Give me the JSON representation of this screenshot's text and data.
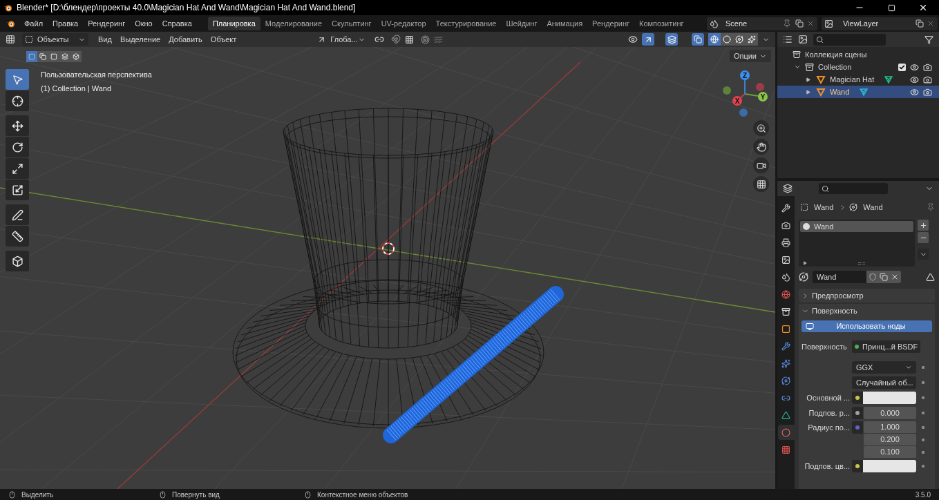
{
  "window": {
    "title": "Blender* [D:\\блендер\\проекты 40.0\\Magician Hat And Wand\\Magician Hat And Wand.blend]"
  },
  "menu": [
    "Файл",
    "Правка",
    "Рендеринг",
    "Окно",
    "Справка"
  ],
  "workspaces": [
    {
      "label": "Планировка",
      "selected": true
    },
    {
      "label": "Моделирование",
      "selected": false
    },
    {
      "label": "Скульптинг",
      "selected": false
    },
    {
      "label": "UV-редактор",
      "selected": false
    },
    {
      "label": "Текстурирование",
      "selected": false
    },
    {
      "label": "Шейдинг",
      "selected": false
    },
    {
      "label": "Анимация",
      "selected": false
    },
    {
      "label": "Рендеринг",
      "selected": false
    },
    {
      "label": "Композитинг",
      "selected": false
    }
  ],
  "scene": {
    "name": "Scene"
  },
  "view_layer": {
    "name": "ViewLayer"
  },
  "viewport_header": {
    "mode": "Объекты",
    "menus": [
      "Вид",
      "Выделение",
      "Добавить",
      "Объект"
    ],
    "orientation": "Глоба...",
    "shading": [
      {
        "kind": "wireframe",
        "selected": true
      },
      {
        "kind": "solid",
        "selected": false
      },
      {
        "kind": "material",
        "selected": false
      },
      {
        "kind": "rendered",
        "selected": false
      }
    ]
  },
  "viewport": {
    "select_modes": [
      {
        "kind": "new",
        "selected": true
      },
      {
        "kind": "extend",
        "selected": false
      },
      {
        "kind": "subtract",
        "selected": false
      },
      {
        "kind": "difference",
        "selected": false
      },
      {
        "kind": "intersect",
        "selected": false
      }
    ],
    "options": "Опции",
    "view_name": "Пользовательская перспектива",
    "object_info": "(1) Collection | Wand",
    "tools": [
      {
        "kind": "select",
        "selected": true
      },
      {
        "kind": "cursor",
        "selected": false
      },
      {
        "kind": "move",
        "selected": false
      },
      {
        "kind": "rotate",
        "selected": false
      },
      {
        "kind": "scale",
        "selected": false
      },
      {
        "kind": "transform",
        "selected": false
      },
      {
        "kind": "annotate",
        "selected": false
      },
      {
        "kind": "measure",
        "selected": false
      },
      {
        "kind": "add_cube",
        "selected": false
      }
    ],
    "gizmo_axes": [
      "X",
      "Y",
      "Z"
    ]
  },
  "outliner": {
    "root": "Коллекция сцены",
    "collection": {
      "name": "Collection",
      "expanded": true,
      "checked": true,
      "children": [
        {
          "name": "Magician Hat",
          "selected": false,
          "color": "#1fbf8f"
        },
        {
          "name": "Wand",
          "selected": true,
          "color": "#29b6d6"
        }
      ]
    }
  },
  "properties": {
    "tabs": [
      {
        "kind": "tool",
        "selected": false
      },
      {
        "kind": "render",
        "selected": false
      },
      {
        "kind": "output",
        "selected": false
      },
      {
        "kind": "view_layer",
        "selected": false
      },
      {
        "kind": "scene",
        "selected": false
      },
      {
        "kind": "world",
        "selected": false
      },
      {
        "kind": "collection",
        "selected": false
      },
      {
        "kind": "object",
        "selected": false
      },
      {
        "kind": "modifiers",
        "selected": false
      },
      {
        "kind": "particles",
        "selected": false
      },
      {
        "kind": "physics",
        "selected": false
      },
      {
        "kind": "constraints",
        "selected": false
      },
      {
        "kind": "data",
        "selected": false
      },
      {
        "kind": "material",
        "selected": true
      },
      {
        "kind": "texture",
        "selected": false
      }
    ],
    "breadcrumb": [
      "Wand",
      "Wand"
    ],
    "slots": [
      {
        "name": "Wand",
        "selected": true
      }
    ],
    "material_name": "Wand",
    "panels": [
      {
        "label": "Предпросмотр",
        "expanded": false
      },
      {
        "label": "Поверхность",
        "expanded": true
      }
    ],
    "use_nodes": "Использовать ноды",
    "rows": [
      {
        "kind": "link",
        "label": "Поверхность",
        "value": "Принц...й BSDF",
        "color": "#4caf50"
      },
      {
        "kind": "dropdown",
        "value": "GGX"
      },
      {
        "kind": "dropdown",
        "value": "Случайный об..."
      },
      {
        "kind": "color",
        "label": "Основной ...",
        "color": "#c7c74a"
      },
      {
        "kind": "number",
        "label": "Подпов. р...",
        "value": "0.000",
        "color": "#a1a1a1"
      },
      {
        "kind": "vector",
        "label": "Радиус по...",
        "values": [
          "1.000",
          "0.200",
          "0.100"
        ],
        "color": "#6363c7"
      },
      {
        "kind": "color",
        "label": "Подпов. цв...",
        "color": "#c7c74a"
      }
    ]
  },
  "status_bar": {
    "hints": [
      "Выделить",
      "Повернуть вид",
      "Контекстное меню объектов"
    ],
    "version": "3.5.0"
  }
}
